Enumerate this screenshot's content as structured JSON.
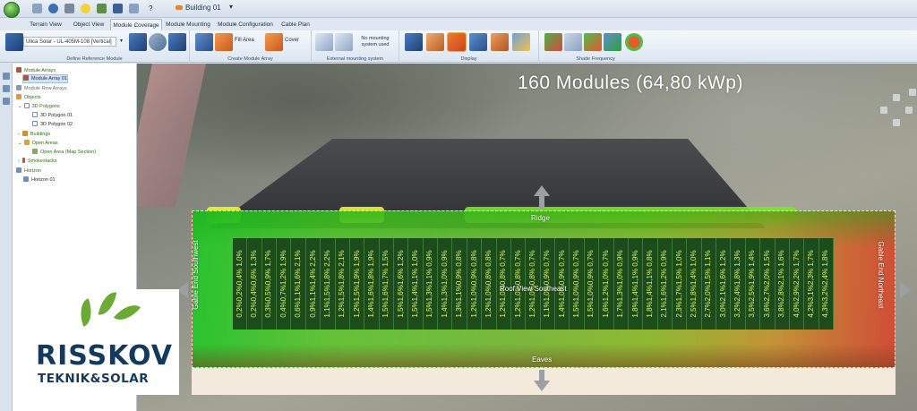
{
  "document": {
    "title": "Building 01"
  },
  "tabs": [
    {
      "label": "Terrain View",
      "active": false
    },
    {
      "label": "Object View",
      "active": false
    },
    {
      "label": "Module Coverage",
      "active": true
    },
    {
      "label": "Module Mounting",
      "active": false
    },
    {
      "label": "Module Configuration",
      "active": false
    },
    {
      "label": "Cable Plan",
      "active": false
    }
  ],
  "ribbon": {
    "module_select": "Ulica Solar - UL-405M-108 [Vertical]",
    "fill_area_label": "Fill Area",
    "cover_label": "Cover",
    "mount_note": "No mounting system used",
    "groups": {
      "define_reference_module": "Define Reference Module",
      "create_module_array": "Create Module Array",
      "external_mounting_system": "External mounting system",
      "display": "Display",
      "shade_frequency": "Shade Frequency"
    }
  },
  "tree": {
    "items": [
      {
        "label": "Module Arrays",
        "level": 0,
        "icon": "module-arrays-icon",
        "group": true
      },
      {
        "label": "Module Array 01",
        "level": 1,
        "icon": "module-array-icon",
        "selected": true
      },
      {
        "label": "Module Row Arrays",
        "level": 0,
        "icon": "module-row-icon",
        "group": false
      },
      {
        "label": "Objects",
        "level": 0,
        "icon": "objects-icon",
        "group": true
      },
      {
        "label": "3D Polygons",
        "level": 1,
        "icon": "polygon-icon",
        "group": true
      },
      {
        "label": "3D Polygon 01",
        "level": 2,
        "icon": "polygon-icon"
      },
      {
        "label": "3D Polygon 02",
        "level": 2,
        "icon": "polygon-icon"
      },
      {
        "label": "Buildings",
        "level": 1,
        "icon": "building-icon",
        "group": true
      },
      {
        "label": "Open Areas",
        "level": 1,
        "icon": "open-area-icon",
        "group": true
      },
      {
        "label": "Open Area (Map Section)",
        "level": 2,
        "icon": "map-icon",
        "group": true
      },
      {
        "label": "Smokestacks",
        "level": 1,
        "icon": "smokestack-icon",
        "group": true
      },
      {
        "label": "Horizon",
        "level": 0,
        "icon": "horizon-icon",
        "group": true
      },
      {
        "label": "Horizon 01",
        "level": 1,
        "icon": "horizon-icon"
      }
    ]
  },
  "logo": {
    "name": "RISSKOV",
    "tagline": "TEKNIK&SOLAR"
  },
  "viewport": {
    "summary": "160 Modules (64,80 kWp)",
    "ridge_label": "Ridge",
    "eaves_label": "Eaves",
    "left_label": "Gable End Southwest",
    "right_label": "Gable End Northeast",
    "center_label": "Roof View Southeast",
    "shade_columns": [
      "0,2%0,2%0,4% 1,0%",
      "0,2%0,4%0,6% 1,3%",
      "0,3%0,5%0,9% 1,7%",
      "0,4%0,7%1,2% 1,9%",
      "0,6%1,1%1,6% 2,1%",
      "0,9%1,1%1,4% 2,2%",
      "1,1%1,5%1,8% 2,2%",
      "1,2%1,5%1,8% 2,1%",
      "1,2%1,5%1,9% 1,9%",
      "1,4%1,6%1,8% 1,9%",
      "1,5%1,6%1,7% 1,5%",
      "1,5%1,6%1,6% 1,2%",
      "1,5%1,4%1,1% 1,0%",
      "1,5%1,3%1,1% 0,9%",
      "1,4%1,3%1,0% 0,9%",
      "1,3%1,1%0,9% 0,8%",
      "1,2%1,0%0,9% 0,8%",
      "1,2%1,0%0,8% 0,8%",
      "1,2%1,0%0,8% 0,7%",
      "1,2%1,0%0,8% 0,7%",
      "1,2%1,0%0,8% 0,7%",
      "1,1%1,0%0,9% 0,7%",
      "1,4%1,0%0,9% 0,7%",
      "1,5%1,0%0,9% 0,7%",
      "1,5%1,0%0,9% 0,7%",
      "1,6%1,2%1,0% 0,7%",
      "1,7%1,3%1,0% 0,9%",
      "1,8%1,4%1,1% 0,9%",
      "1,8%1,4%1,1% 0,8%",
      "2,1%1,6%1,2% 0,9%",
      "2,3%1,7%1,5% 1,0%",
      "2,5%1,8%1,4% 1,0%",
      "2,7%2,0%1,5% 1,1%",
      "3,0%2,1%1,6% 1,2%",
      "3,2%2,4%1,8% 1,3%",
      "3,5%2,5%1,9% 1,4%",
      "3,6%2,7%2,0% 1,5%",
      "3,8%2,8%2,1% 1,6%",
      "4,0%2,9%2,2% 1,7%",
      "4,2%3,1%2,3% 1,7%",
      "4,3%3,2%2,4% 1,8%"
    ]
  },
  "colors": {
    "accent": "#2f6d1c",
    "logo_blue": "#13395f",
    "logo_green": "#6cab33",
    "shade_text": "#d7f56a"
  }
}
